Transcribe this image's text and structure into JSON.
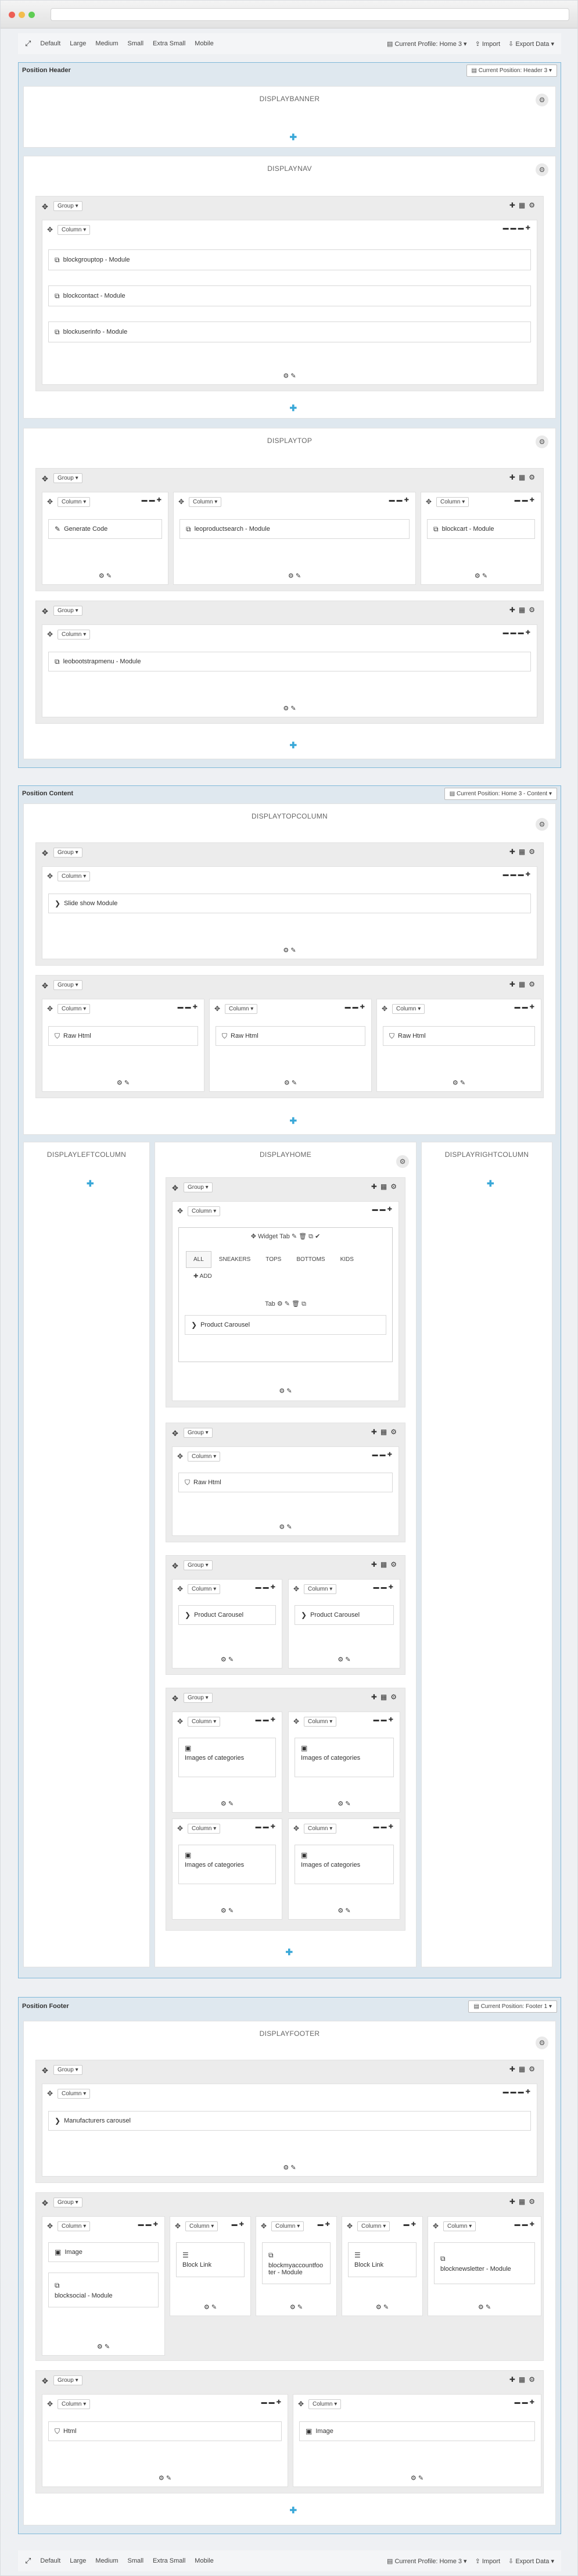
{
  "toolbar": {
    "items": [
      "Default",
      "Large",
      "Medium",
      "Small",
      "Extra Small",
      "Mobile"
    ],
    "profile": "Current Profile: Home 3",
    "import": "Import",
    "export": "Export Data"
  },
  "labels": {
    "group": "Group",
    "column": "Column",
    "add_tab": "ADD",
    "widget_tab": "Widget Tab",
    "tab": "Tab"
  },
  "header": {
    "title": "Position Header",
    "position": "Current Position: Header 3",
    "displaybanner": "DISPLAYBANNER",
    "displaynav": "DISPLAYNAV",
    "displaytop": "DISPLAYTOP",
    "nav_modules": [
      "blockgrouptop - Module",
      "blockcontact - Module",
      "blockuserinfo - Module"
    ],
    "top_modules": [
      "Generate Code",
      "leoproductsearch - Module",
      "blockcart - Module"
    ],
    "top2_module": "leobootstrapmenu - Module"
  },
  "content": {
    "title": "Position Content",
    "position": "Current Position: Home 3 - Content",
    "topcolumn": "DISPLAYTOPCOLUMN",
    "slideshow": "Slide show Module",
    "raw_html": "Raw Html",
    "leftcolumn": "DISPLAYLEFTCOLUMN",
    "home": "DISPLAYHOME",
    "rightcolumn": "DISPLAYRIGHTCOLUMN",
    "tabs": [
      "ALL",
      "SNEAKERS",
      "TOPS",
      "BOTTOMS",
      "KIDS"
    ],
    "product_carousel": "Product Carousel",
    "images_of_categories": "Images of categories"
  },
  "footer": {
    "title": "Position Footer",
    "position": "Current Position: Footer 1",
    "displayfooter": "DISPLAYFOOTER",
    "manufacturers": "Manufacturers carousel",
    "image": "Image",
    "blocksocial": "blocksocial - Module",
    "block_link": "Block Link",
    "myaccount": "blockmyaccountfooter - Module",
    "newsletter": "blocknewsletter - Module",
    "html": "Html"
  }
}
